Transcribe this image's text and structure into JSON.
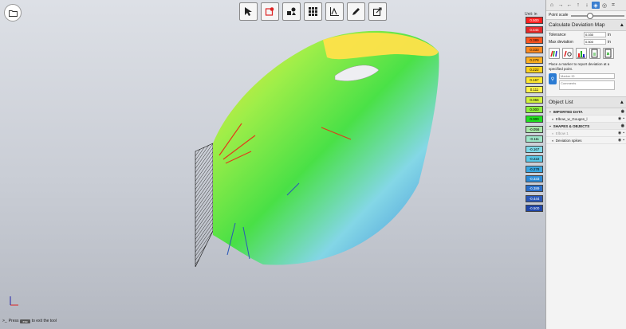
{
  "legend": {
    "unit_label": "Unit: in",
    "items": [
      {
        "label": "0.500",
        "color": "#ff2020",
        "text": "#ffffff"
      },
      {
        "label": "0.444",
        "color": "#e62a2a",
        "text": "#ffffff"
      },
      {
        "label": "0.389",
        "color": "#ff5520",
        "text": "#000000"
      },
      {
        "label": "0.333",
        "color": "#ff8a20",
        "text": "#000000"
      },
      {
        "label": "0.278",
        "color": "#ffb020",
        "text": "#000000"
      },
      {
        "label": "0.222",
        "color": "#ffd21e",
        "text": "#000000"
      },
      {
        "label": "0.167",
        "color": "#ffe830",
        "text": "#000000"
      },
      {
        "label": "0.111",
        "color": "#fff24a",
        "text": "#000000"
      },
      {
        "label": "0.056",
        "color": "#d2f23c",
        "text": "#000000"
      },
      {
        "label": "0.000",
        "color": "#8cf03c",
        "text": "#000000"
      },
      {
        "label": "0.000",
        "color": "#20e020",
        "text": "#000000"
      },
      {
        "label": "-0.056",
        "color": "#a8e6a8",
        "text": "#000000"
      },
      {
        "label": "-0.111",
        "color": "#9ee6c8",
        "text": "#000000"
      },
      {
        "label": "-0.167",
        "color": "#7ed8e8",
        "text": "#000000"
      },
      {
        "label": "-0.222",
        "color": "#5ac8e8",
        "text": "#000000"
      },
      {
        "label": "-0.278",
        "color": "#3aa6e0",
        "text": "#000000"
      },
      {
        "label": "-0.333",
        "color": "#2b8ad6",
        "text": "#ffffff"
      },
      {
        "label": "-0.389",
        "color": "#2a6ec8",
        "text": "#ffffff"
      },
      {
        "label": "-0.444",
        "color": "#2a58b8",
        "text": "#ffffff"
      },
      {
        "label": "-0.500",
        "color": "#1f46a8",
        "text": "#ffffff"
      }
    ]
  },
  "panel": {
    "point_scale_label": "Point scale",
    "point_scale_value": 0.3,
    "deviation": {
      "title": "Calculate Deviation Map",
      "tolerance_label": "Tolerance",
      "tolerance_value": "0.030",
      "tolerance_unit": "in",
      "max_dev_label": "Max deviation",
      "max_dev_value": "0.500",
      "max_dev_unit": "in",
      "marker_note": "Place a marker to report deviation at a specified point.",
      "marker_placeholder": "Marker ID",
      "comment_placeholder": "Comments"
    },
    "object_list": {
      "title": "Object List",
      "rows": [
        {
          "label": "IMPORTED DATA",
          "group": true
        },
        {
          "label": "Elbow_w_Gouges_l",
          "group": false
        },
        {
          "label": "SHAPES & OBJECTS",
          "group": true
        },
        {
          "label": "Elbow 1",
          "group": false,
          "dim": true
        },
        {
          "label": "Deviation spikes",
          "group": false
        }
      ]
    }
  },
  "status": {
    "prefix": "Press",
    "key": "esc",
    "suffix": "to exit the tool"
  },
  "axes": {
    "x": "x",
    "z": "z"
  }
}
